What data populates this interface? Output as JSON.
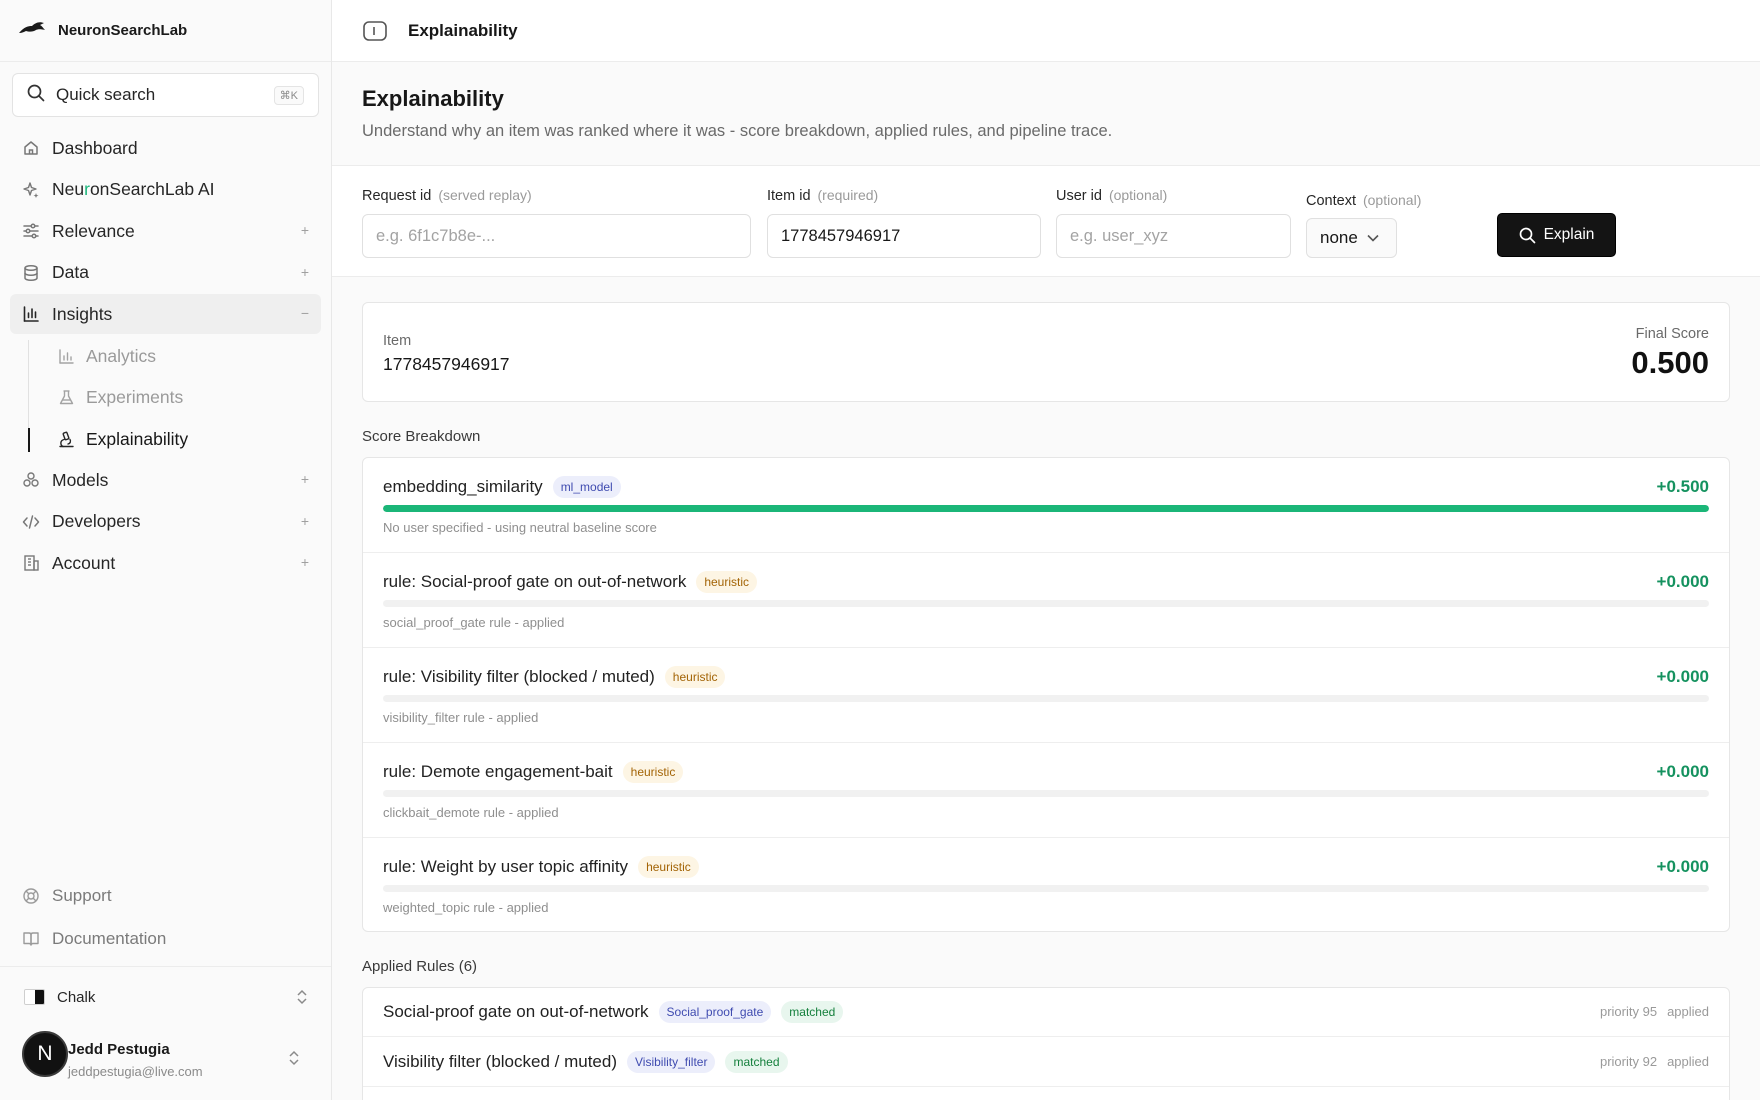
{
  "brand": {
    "name": "NeuronSearchLab"
  },
  "search": {
    "label": "Quick search",
    "shortcut": "⌘K"
  },
  "sidebar": {
    "items": [
      {
        "label": "Dashboard",
        "icon": "home-icon"
      },
      {
        "label_pre": "Neu",
        "label_accent": "r",
        "label_post": "onSearchLab AI",
        "icon": "sparkle-icon"
      },
      {
        "label": "Relevance",
        "icon": "sliders-icon"
      },
      {
        "label": "Data",
        "icon": "database-icon"
      },
      {
        "label": "Insights",
        "icon": "bar-chart-icon"
      },
      {
        "label": "Models",
        "icon": "boxes-icon"
      },
      {
        "label": "Developers",
        "icon": "code-icon"
      },
      {
        "label": "Account",
        "icon": "building-icon"
      }
    ],
    "insights_sub": [
      {
        "label": "Analytics",
        "icon": "chart-icon"
      },
      {
        "label": "Experiments",
        "icon": "flask-icon"
      },
      {
        "label": "Explainability",
        "icon": "microscope-icon"
      }
    ],
    "expand_symbol": "+",
    "collapse_symbol": "−",
    "bottom": [
      {
        "label": "Support",
        "icon": "lifebuoy-icon"
      },
      {
        "label": "Documentation",
        "icon": "book-icon"
      }
    ],
    "theme": "Chalk",
    "user": {
      "initial": "N",
      "name": "Jedd Pestugia",
      "email": "jeddpestugia@live.com"
    }
  },
  "topbar": {
    "title": "Explainability"
  },
  "page": {
    "title": "Explainability",
    "subtitle": "Understand why an item was ranked where it was - score breakdown, applied rules, and pipeline trace."
  },
  "form": {
    "request_id": {
      "label": "Request id",
      "hint": "(served replay)",
      "placeholder": "e.g. 6f1c7b8e-...",
      "value": ""
    },
    "item_id": {
      "label": "Item id",
      "hint": "(required)",
      "placeholder": "",
      "value": "1778457946917"
    },
    "user_id": {
      "label": "User id",
      "hint": "(optional)",
      "placeholder": "e.g. user_xyz",
      "value": ""
    },
    "context": {
      "label": "Context",
      "hint": "(optional)",
      "value": "none"
    },
    "explain_label": "Explain"
  },
  "item_summary": {
    "item_label": "Item",
    "item_id": "1778457946917",
    "final_score_label": "Final Score",
    "final_score": "0.500"
  },
  "score_breakdown": {
    "title": "Score Breakdown",
    "rows": [
      {
        "name": "embedding_similarity",
        "tag": "ml_model",
        "value": "+0.500",
        "fill": 1.0,
        "note": "No user specified - using neutral baseline score"
      },
      {
        "name": "rule: Social-proof gate on out-of-network",
        "tag": "heuristic",
        "value": "+0.000",
        "fill": 0.0,
        "note": "social_proof_gate rule - applied"
      },
      {
        "name": "rule: Visibility filter (blocked / muted)",
        "tag": "heuristic",
        "value": "+0.000",
        "fill": 0.0,
        "note": "visibility_filter rule - applied"
      },
      {
        "name": "rule: Demote engagement-bait",
        "tag": "heuristic",
        "value": "+0.000",
        "fill": 0.0,
        "note": "clickbait_demote rule - applied"
      },
      {
        "name": "rule: Weight by user topic affinity",
        "tag": "heuristic",
        "value": "+0.000",
        "fill": 0.0,
        "note": "weighted_topic rule - applied"
      }
    ]
  },
  "applied_rules": {
    "title": "Applied Rules (6)",
    "rows": [
      {
        "name": "Social-proof gate on out-of-network",
        "type": "Social_proof_gate",
        "status": "matched",
        "priority": "priority 95",
        "state": "applied"
      },
      {
        "name": "Visibility filter (blocked / muted)",
        "type": "Visibility_filter",
        "status": "matched",
        "priority": "priority 92",
        "state": "applied"
      }
    ]
  },
  "colors": {
    "accent_green": "#1bb678",
    "primary_button": "#141414"
  }
}
